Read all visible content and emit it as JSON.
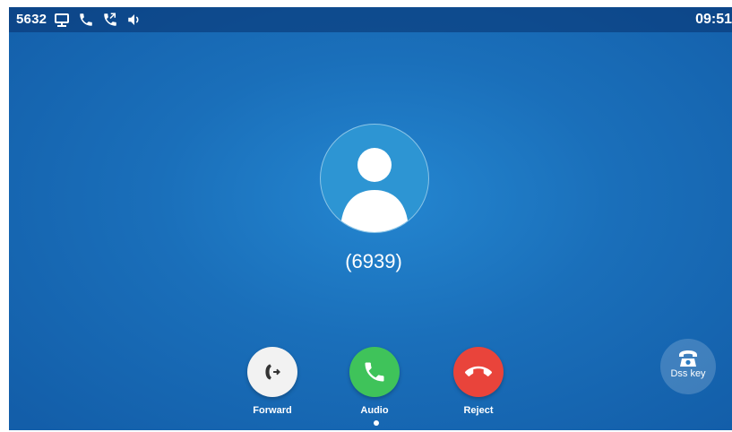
{
  "status_bar": {
    "extension": "5632",
    "clock": "09:51",
    "icons": [
      "network-icon",
      "phone-icon",
      "call-forward-icon",
      "volume-icon"
    ]
  },
  "call": {
    "caller_display": "(6939)",
    "avatar_icon": "contact-avatar-icon"
  },
  "actions": {
    "forward": {
      "label": "Forward",
      "icon": "call-forward-icon",
      "color": "#f2f2f2"
    },
    "audio": {
      "label": "Audio",
      "icon": "phone-answer-icon",
      "color": "#3fc35a"
    },
    "reject": {
      "label": "Reject",
      "icon": "phone-hangup-icon",
      "color": "#e9443b"
    }
  },
  "dss": {
    "label": "Dss key",
    "icon": "telephone-icon"
  },
  "colors": {
    "background": "#1a6fba",
    "accept": "#3fc35a",
    "reject": "#e9443b"
  }
}
